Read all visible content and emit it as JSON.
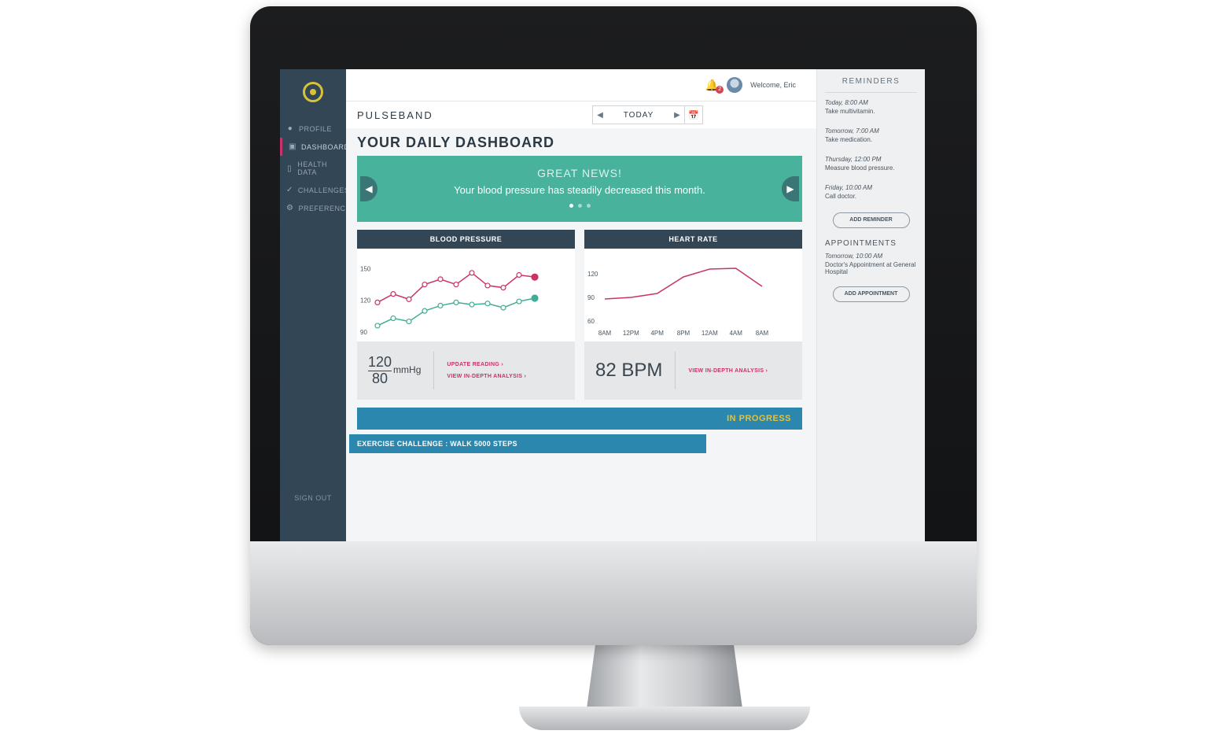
{
  "top": {
    "welcome": "Welcome, Eric",
    "notification_count": "2"
  },
  "brand": "PULSEBAND",
  "date_nav": {
    "label": "TODAY"
  },
  "page_title": "YOUR DAILY DASHBOARD",
  "sidebar": {
    "items": [
      {
        "label": "PROFILE",
        "icon": "user-icon"
      },
      {
        "label": "DASHBOARD",
        "icon": "dashboard-icon",
        "active": true
      },
      {
        "label": "HEALTH DATA",
        "icon": "chart-icon"
      },
      {
        "label": "CHALLENGES",
        "icon": "check-icon"
      },
      {
        "label": "PREFERENCES",
        "icon": "gear-icon"
      }
    ],
    "signout": "SIGN OUT"
  },
  "banner": {
    "heading": "GREAT NEWS!",
    "message": "Your blood pressure has steadily decreased this month."
  },
  "blood_pressure": {
    "title": "BLOOD PRESSURE",
    "systolic": "120",
    "diastolic": "80",
    "unit": "mmHg",
    "link_update": "UPDATE READING ›",
    "link_analysis": "VIEW IN-DEPTH ANALYSIS ›",
    "y_ticks": [
      "150",
      "120",
      "90"
    ]
  },
  "heart_rate": {
    "title": "HEART RATE",
    "value": "82 BPM",
    "link_analysis": "VIEW IN-DEPTH ANALYSIS ›",
    "y_ticks": [
      "120",
      "90",
      "60"
    ],
    "x_ticks": [
      "8AM",
      "12PM",
      "4PM",
      "8PM",
      "12AM",
      "4AM",
      "8AM"
    ]
  },
  "challenge": {
    "status": "IN PROGRESS",
    "label": "EXERCISE CHALLENGE : WALK 5000 STEPS"
  },
  "reminders": {
    "title": "REMINDERS",
    "items": [
      {
        "when": "Today, 8:00 AM",
        "what": "Take multivitamin."
      },
      {
        "when": "Tomorrow, 7:00 AM",
        "what": "Take medication."
      },
      {
        "when": "Thursday, 12:00 PM",
        "what": "Measure blood pressure."
      },
      {
        "when": "Friday, 10:00 AM",
        "what": "Call doctor."
      }
    ],
    "add_button": "ADD REMINDER"
  },
  "appointments": {
    "title": "APPOINTMENTS",
    "items": [
      {
        "when": "Tomorrow, 10:00 AM",
        "what": "Doctor's Appointment at General Hospital"
      }
    ],
    "add_button": "ADD APPOINTMENT"
  },
  "colors": {
    "sidebar": "#334655",
    "accent_teal": "#48b29d",
    "accent_pink": "#c9336b",
    "accent_blue": "#2b87ad",
    "accent_yellow": "#e6c23c"
  },
  "chart_data": [
    {
      "type": "line",
      "title": "BLOOD PRESSURE",
      "ylim": [
        90,
        160
      ],
      "y_ticks": [
        150,
        120,
        90
      ],
      "series": [
        {
          "values": [
            118,
            126,
            121,
            135,
            140,
            135,
            146,
            134,
            132,
            144,
            142
          ]
        },
        {
          "values": [
            96,
            103,
            100,
            110,
            115,
            118,
            116,
            117,
            113,
            119,
            122
          ]
        }
      ]
    },
    {
      "type": "line",
      "title": "HEART RATE",
      "x": [
        "8AM",
        "12PM",
        "4PM",
        "8PM",
        "12AM",
        "4AM",
        "8AM"
      ],
      "ylim": [
        60,
        140
      ],
      "y_ticks": [
        120,
        90,
        60
      ],
      "series": [
        {
          "values": [
            88,
            90,
            95,
            116,
            126,
            127,
            104
          ]
        }
      ]
    }
  ]
}
